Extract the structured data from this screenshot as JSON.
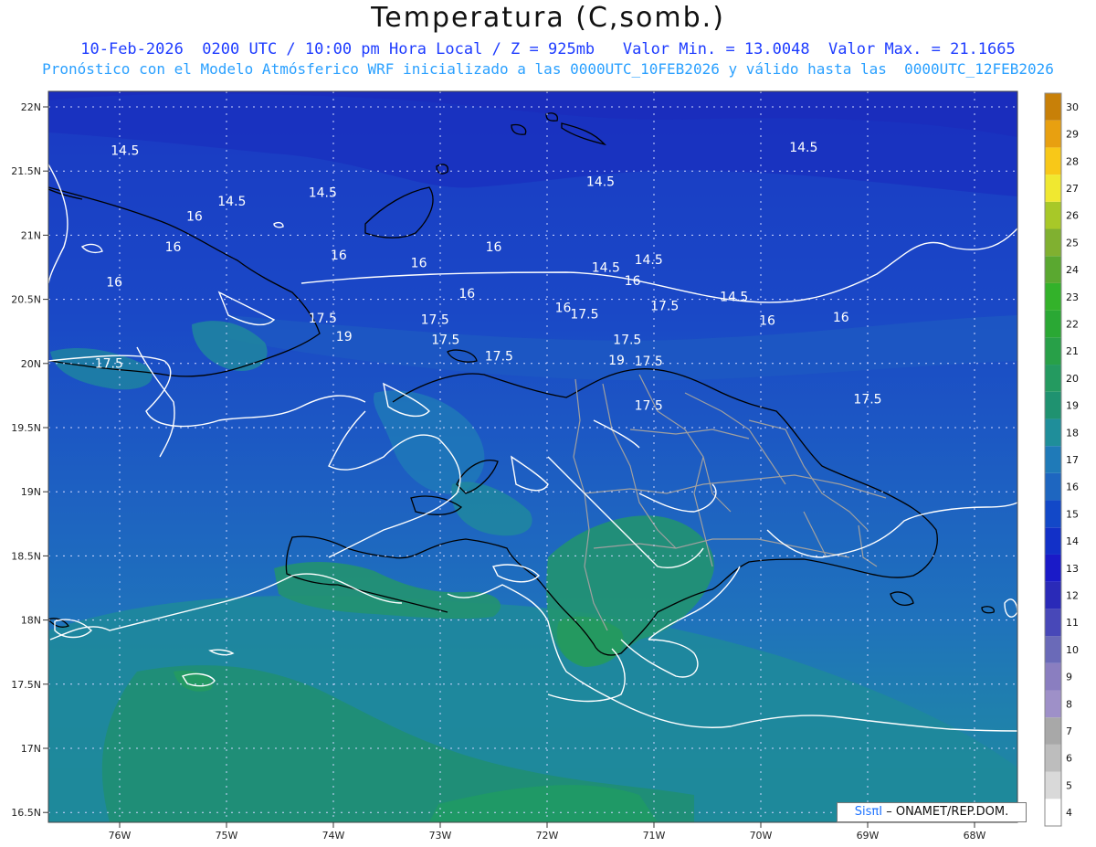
{
  "header": {
    "title": "Temperatura (C,somb.)",
    "line1": "10-Feb-2026  0200 UTC / 10:00 pm Hora Local / Z = 925mb   Valor Min. = 13.0048  Valor Max. = 21.1665",
    "line2": "Pronóstico con el Modelo Atmósferico WRF inicializado a las 0000UTC_10FEB2026 y válido hasta las  0000UTC_12FEB2026"
  },
  "axes": {
    "lat_labels": [
      "22N",
      "21.5N",
      "21N",
      "20.5N",
      "20N",
      "19.5N",
      "19N",
      "18.5N",
      "18N",
      "17.5N",
      "17N",
      "16.5N"
    ],
    "lon_labels": [
      "76W",
      "75W",
      "74W",
      "73W",
      "72W",
      "71W",
      "70W",
      "69W",
      "68W"
    ]
  },
  "contour_labels": [
    {
      "text": "14.5",
      "lon": -75.95,
      "lat": 21.25
    },
    {
      "text": "14.5",
      "lon": -74.95,
      "lat": 20.46
    },
    {
      "text": "14.5",
      "lon": -74.1,
      "lat": 20.6
    },
    {
      "text": "14.5",
      "lon": -71.5,
      "lat": 20.77
    },
    {
      "text": "14.5",
      "lon": -69.6,
      "lat": 21.3
    },
    {
      "text": "14.5",
      "lon": -71.45,
      "lat": 19.43
    },
    {
      "text": "14.5",
      "lon": -71.05,
      "lat": 19.55
    },
    {
      "text": "14.5",
      "lon": -70.25,
      "lat": 18.97
    },
    {
      "text": "16",
      "lon": -75.3,
      "lat": 20.23
    },
    {
      "text": "16",
      "lon": -75.5,
      "lat": 19.75
    },
    {
      "text": "16",
      "lon": -73.95,
      "lat": 19.62
    },
    {
      "text": "16",
      "lon": -76.05,
      "lat": 19.2
    },
    {
      "text": "16",
      "lon": -73.2,
      "lat": 19.5
    },
    {
      "text": "16",
      "lon": -72.5,
      "lat": 19.75
    },
    {
      "text": "16",
      "lon": -72.75,
      "lat": 19.02
    },
    {
      "text": "16",
      "lon": -71.85,
      "lat": 18.8
    },
    {
      "text": "16",
      "lon": -71.2,
      "lat": 19.22
    },
    {
      "text": "16",
      "lon": -69.94,
      "lat": 18.6
    },
    {
      "text": "16",
      "lon": -69.25,
      "lat": 18.65
    },
    {
      "text": "17.5",
      "lon": -74.1,
      "lat": 18.64
    },
    {
      "text": "17.5",
      "lon": -73.05,
      "lat": 18.62
    },
    {
      "text": "17.5",
      "lon": -72.95,
      "lat": 18.3
    },
    {
      "text": "17.5",
      "lon": -71.65,
      "lat": 18.7
    },
    {
      "text": "17.5",
      "lon": -70.9,
      "lat": 18.83
    },
    {
      "text": "17.5",
      "lon": -71.25,
      "lat": 18.3
    },
    {
      "text": "17.5",
      "lon": -72.45,
      "lat": 18.05
    },
    {
      "text": "17.5",
      "lon": -76.1,
      "lat": 17.93
    },
    {
      "text": "17.5",
      "lon": -71.05,
      "lat": 17.97
    },
    {
      "text": "17.5",
      "lon": -71.05,
      "lat": 17.28
    },
    {
      "text": "17.5",
      "lon": -69.0,
      "lat": 17.38
    },
    {
      "text": "19",
      "lon": -73.9,
      "lat": 18.35
    },
    {
      "text": "19",
      "lon": -71.35,
      "lat": 17.98
    }
  ],
  "colorbar": {
    "levels": [
      "4",
      "5",
      "6",
      "7",
      "8",
      "9",
      "10",
      "11",
      "12",
      "13",
      "14",
      "15",
      "16",
      "17",
      "18",
      "19",
      "20",
      "21",
      "22",
      "23",
      "24",
      "25",
      "26",
      "27",
      "28",
      "29",
      "30"
    ],
    "colors": [
      "#ffffff",
      "#d9d9d9",
      "#bdbdbd",
      "#a8a8a8",
      "#9e90c8",
      "#8a7ec0",
      "#6a6ab8",
      "#4848b8",
      "#2a2ab8",
      "#1a1ac8",
      "#1230c8",
      "#1248c8",
      "#1e66c0",
      "#1f7ab8",
      "#1f8e9a",
      "#1f9270",
      "#249a60",
      "#28a048",
      "#2aa834",
      "#33b22a",
      "#5aa830",
      "#80b030",
      "#a8c828",
      "#f0e830",
      "#f8c818",
      "#e8a010",
      "#c88008"
    ]
  },
  "credit": {
    "brand": "SisπI",
    "text": "– ONAMET/REP.DOM."
  }
}
